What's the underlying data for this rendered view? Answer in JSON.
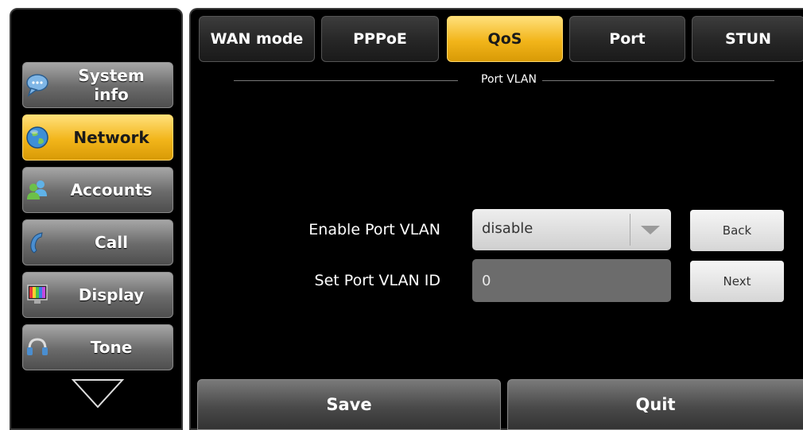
{
  "sidebar": {
    "items": [
      {
        "label": "System info",
        "icon": "chat-bubble-icon",
        "active": false
      },
      {
        "label": "Network",
        "icon": "globe-icon",
        "active": true
      },
      {
        "label": "Accounts",
        "icon": "users-icon",
        "active": false
      },
      {
        "label": "Call",
        "icon": "phone-handset-icon",
        "active": false
      },
      {
        "label": "Display",
        "icon": "monitor-icon",
        "active": false
      },
      {
        "label": "Tone",
        "icon": "headset-icon",
        "active": false
      }
    ],
    "scroll_down_icon": "triangle-down-icon"
  },
  "tabs": [
    {
      "label": "WAN mode",
      "active": false
    },
    {
      "label": "PPPoE",
      "active": false
    },
    {
      "label": "QoS",
      "active": true
    },
    {
      "label": "Port",
      "active": false
    },
    {
      "label": "STUN",
      "active": false
    }
  ],
  "section": {
    "title": "Port VLAN"
  },
  "form": {
    "enable_port_vlan": {
      "label": "Enable Port VLAN",
      "value": "disable"
    },
    "port_vlan_id": {
      "label": "Set Port VLAN ID",
      "value": "0"
    }
  },
  "buttons": {
    "back": "Back",
    "next": "Next",
    "save": "Save",
    "quit": "Quit"
  },
  "colors": {
    "accent": "#f2b51a",
    "background": "#000000",
    "button_gray": "#5a5a5a"
  }
}
